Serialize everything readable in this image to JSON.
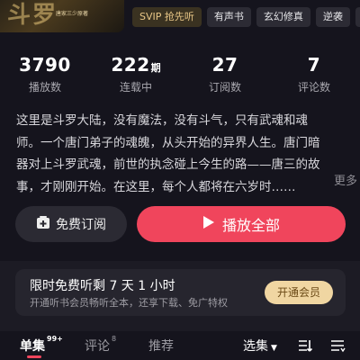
{
  "cover": {
    "title_art": "斗罗",
    "subtitle": "唐家三少原著"
  },
  "tags": [
    {
      "label": "SVIP 抢先听"
    },
    {
      "label": "有声书"
    },
    {
      "label": "玄幻修真"
    },
    {
      "label": "逆袭"
    },
    {
      "label": "›"
    }
  ],
  "stats": [
    {
      "value": "3790",
      "unit": "",
      "label": "播放数"
    },
    {
      "value": "222",
      "unit": "期",
      "label": "连载中"
    },
    {
      "value": "27",
      "unit": "",
      "label": "订阅数"
    },
    {
      "value": "7",
      "unit": "",
      "label": "评论数"
    }
  ],
  "description": "这里是斗罗大陆，没有魔法，没有斗气，只有武魂和魂师。一个唐门弟子的魂魄，从头开始的异界人生。唐门暗器对上斗罗武魂，前世的执念碰上今生的路——唐三的故事，才刚刚开始。在这里，每个人都将在六岁时……",
  "description_more": "更多",
  "actions": {
    "subscribe_label": "免费订阅",
    "play_all_label": "播放全部"
  },
  "promo": {
    "title": "限时免费听剩 7 天 1 小时",
    "subtitle": "开通听书会员畅听全本，还享下载、免广特权",
    "button": "开通会员"
  },
  "tabs": [
    {
      "label": "单集",
      "badge": "99+"
    },
    {
      "label": "评论",
      "badge": "8"
    },
    {
      "label": "推荐",
      "badge": ""
    }
  ],
  "select_episodes": "选集",
  "icons": [
    "sort-icon",
    "filter-icon"
  ],
  "colors": {
    "accent": "#f0455c",
    "gold": "#f0d6a2",
    "background": "#15141d"
  }
}
